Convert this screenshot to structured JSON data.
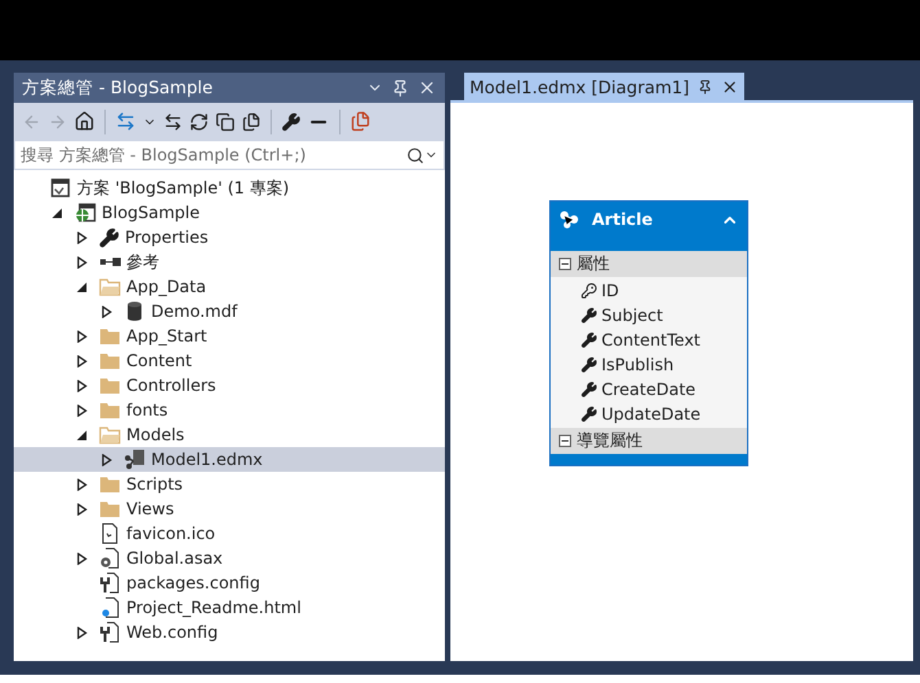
{
  "solution_explorer": {
    "title": "方案總管 - BlogSample",
    "search": {
      "placeholder": "搜尋 方案總管 - BlogSample (Ctrl+;)"
    },
    "tree": [
      {
        "label": "方案 'BlogSample' (1 專案)",
        "kind": "solution",
        "selected": false,
        "children": [
          {
            "label": "BlogSample",
            "kind": "project",
            "expanded": true,
            "selected": false,
            "children": [
              {
                "label": "Properties",
                "kind": "properties",
                "expanded": false,
                "selected": false
              },
              {
                "label": "參考",
                "kind": "references",
                "expanded": false,
                "selected": false
              },
              {
                "label": "App_Data",
                "kind": "folder-open",
                "expanded": true,
                "selected": false,
                "children": [
                  {
                    "label": "Demo.mdf",
                    "kind": "database",
                    "expanded": false,
                    "selected": false
                  }
                ]
              },
              {
                "label": "App_Start",
                "kind": "folder",
                "expanded": false,
                "selected": false
              },
              {
                "label": "Content",
                "kind": "folder",
                "expanded": false,
                "selected": false
              },
              {
                "label": "Controllers",
                "kind": "folder",
                "expanded": false,
                "selected": false
              },
              {
                "label": "fonts",
                "kind": "folder",
                "expanded": false,
                "selected": false
              },
              {
                "label": "Models",
                "kind": "folder-open",
                "expanded": true,
                "selected": false,
                "children": [
                  {
                    "label": "Model1.edmx",
                    "kind": "edmx",
                    "expanded": false,
                    "selected": true
                  }
                ]
              },
              {
                "label": "Scripts",
                "kind": "folder",
                "expanded": false,
                "selected": false
              },
              {
                "label": "Views",
                "kind": "folder",
                "expanded": false,
                "selected": false
              },
              {
                "label": "favicon.ico",
                "kind": "image",
                "selected": false
              },
              {
                "label": "Global.asax",
                "kind": "asax",
                "expanded": false,
                "selected": false
              },
              {
                "label": "packages.config",
                "kind": "config",
                "selected": false
              },
              {
                "label": "Project_Readme.html",
                "kind": "html",
                "selected": false
              },
              {
                "label": "Web.config",
                "kind": "config",
                "expanded": false,
                "selected": false
              }
            ]
          }
        ]
      }
    ]
  },
  "document_tabs": [
    {
      "label": "Model1.edmx [Diagram1]",
      "selected": true
    }
  ],
  "entity": {
    "name": "Article",
    "sections": [
      {
        "label": "屬性",
        "expanded": true,
        "items": [
          {
            "label": "ID",
            "kind": "key"
          },
          {
            "label": "Subject",
            "kind": "property"
          },
          {
            "label": "ContentText",
            "kind": "property"
          },
          {
            "label": "IsPublish",
            "kind": "property"
          },
          {
            "label": "CreateDate",
            "kind": "property"
          },
          {
            "label": "UpdateDate",
            "kind": "property"
          }
        ]
      },
      {
        "label": "導覽屬性",
        "expanded": true
      }
    ]
  }
}
